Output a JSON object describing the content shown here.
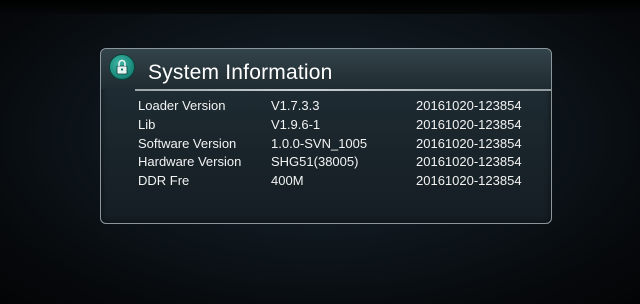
{
  "dialog": {
    "title": "System Information",
    "icon": "lock-icon"
  },
  "rows": [
    {
      "label": "Loader Version",
      "value": "V1.7.3.3",
      "date": "20161020-123854"
    },
    {
      "label": "Lib",
      "value": "V1.9.6-1",
      "date": "20161020-123854"
    },
    {
      "label": "Software Version",
      "value": "1.0.0-SVN_1005",
      "date": "20161020-123854"
    },
    {
      "label": "Hardware Version",
      "value": "SHG51(38005)",
      "date": "20161020-123854"
    },
    {
      "label": "DDR Fre",
      "value": "400M",
      "date": "20161020-123854"
    }
  ],
  "colors": {
    "icon_teal": "#1d8d7f",
    "text": "#f2f2f2",
    "border": "#8c979c"
  }
}
